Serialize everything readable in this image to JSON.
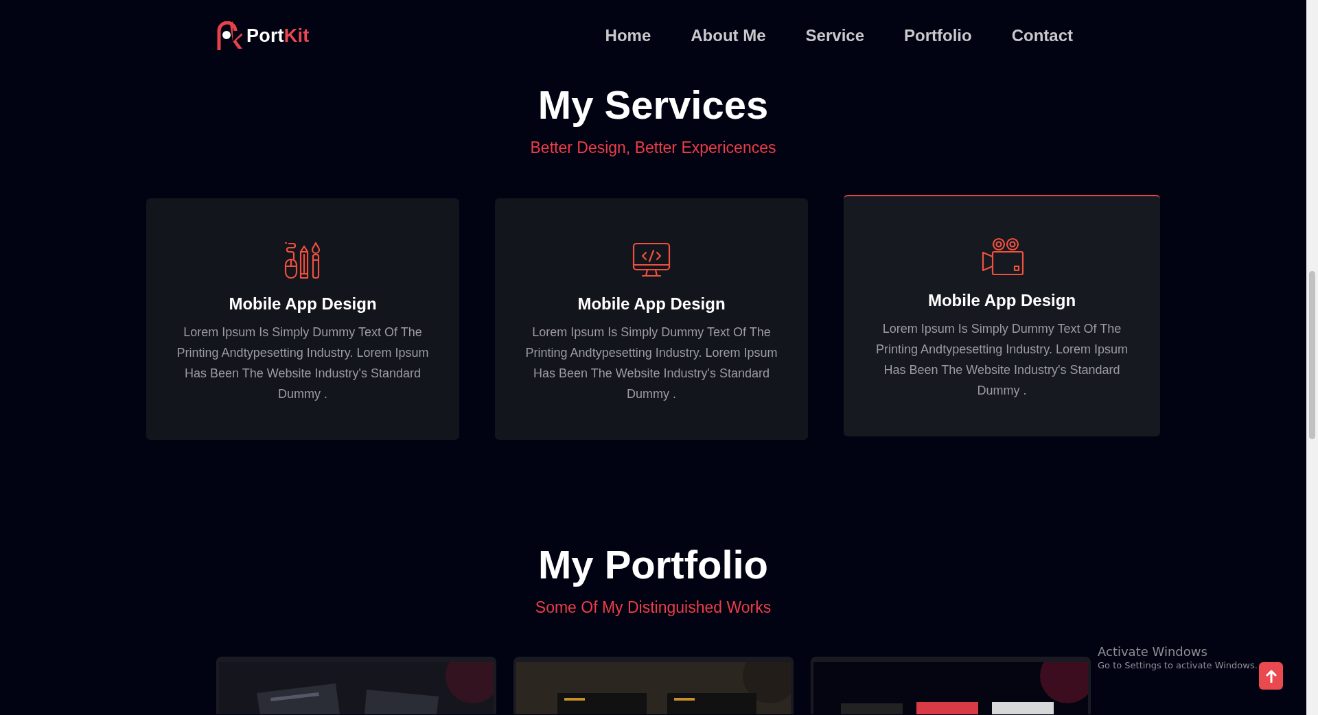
{
  "header": {
    "logo": {
      "name": "Port",
      "accent": "Kit"
    },
    "nav": [
      {
        "label": "Home"
      },
      {
        "label": "About Me"
      },
      {
        "label": "Service"
      },
      {
        "label": "Portfolio"
      },
      {
        "label": "Contact"
      }
    ]
  },
  "services": {
    "title": "My Services",
    "subtitle": "Better Design, Better Expericences",
    "cards": [
      {
        "kind": "tools",
        "title": "Mobile App Design",
        "text": "Lorem Ipsum Is Simply Dummy Text Of The Printing Andtypesetting Industry. Lorem Ipsum Has Been The Website Industry's Standard Dummy .",
        "highlighted": false
      },
      {
        "kind": "monitor",
        "title": "Mobile App Design",
        "text": "Lorem Ipsum Is Simply Dummy Text Of The Printing Andtypesetting Industry. Lorem Ipsum Has Been The Website Industry's Standard Dummy .",
        "highlighted": false
      },
      {
        "kind": "camera",
        "title": "Mobile App Design",
        "text": "Lorem Ipsum Is Simply Dummy Text Of The Printing Andtypesetting Industry. Lorem Ipsum Has Been The Website Industry's Standard Dummy .",
        "highlighted": true
      }
    ]
  },
  "portfolio": {
    "title": "My Portfolio",
    "subtitle": "Some Of My Distinguished Works"
  },
  "windows_notice": {
    "title": "Activate Windows",
    "text": "Go to Settings to activate Windows."
  }
}
